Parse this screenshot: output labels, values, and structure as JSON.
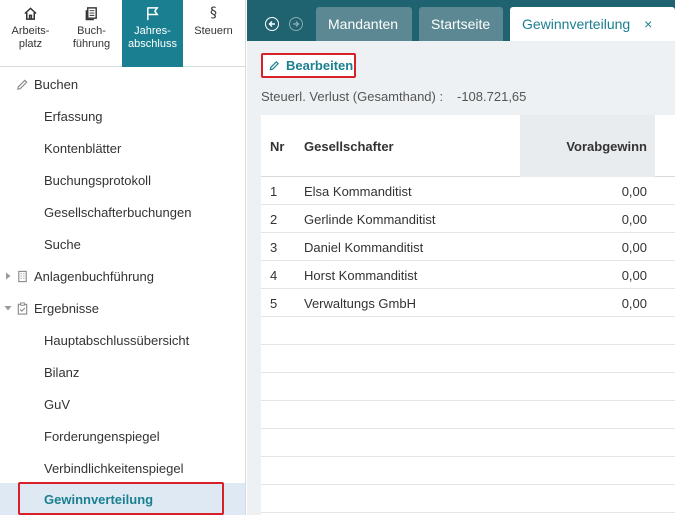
{
  "topnav": [
    {
      "label": "Arbeits-\nplatz",
      "icon": "home-icon",
      "active": false
    },
    {
      "label": "Buch-\nführung",
      "icon": "documents-icon",
      "active": false
    },
    {
      "label": "Jahres-\nabschluss",
      "icon": "flag-icon",
      "active": true
    },
    {
      "label": "Steuern",
      "icon": "paragraph-icon",
      "active": false
    }
  ],
  "tree": {
    "buchen": "Buchen",
    "erfassung": "Erfassung",
    "kontenblaetter": "Kontenblätter",
    "buchungsprotokoll": "Buchungsprotokoll",
    "gesellschafterbuchungen": "Gesellschafterbuchungen",
    "suche": "Suche",
    "anlagenbuchfuehrung": "Anlagenbuchführung",
    "ergebnisse": "Ergebnisse",
    "hauptabschlussuebersicht": "Hauptabschlussübersicht",
    "bilanz": "Bilanz",
    "guv": "GuV",
    "forderungsspiegel": "Forderungenspiegel",
    "verbindlichkeitenspiegel": "Verbindlichkeitenspiegel",
    "gewinnverteilung": "Gewinnverteilung"
  },
  "tabs": {
    "mandanten": "Mandanten",
    "startseite": "Startseite",
    "gewinnverteilung": "Gewinnverteilung",
    "close": "×"
  },
  "content": {
    "edit_label": "Bearbeiten",
    "verlust_label": "Steuerl. Verlust (Gesamthand) :",
    "verlust_value": "-108.721,65"
  },
  "table": {
    "headers": {
      "nr": "Nr",
      "gesellschafter": "Gesellschafter",
      "vorabgewinn": "Vorabgewinn"
    },
    "rows": [
      {
        "nr": "1",
        "name": "Elsa Kommanditist",
        "vorab": "0,00"
      },
      {
        "nr": "2",
        "name": "Gerlinde Kommanditist",
        "vorab": "0,00"
      },
      {
        "nr": "3",
        "name": "Daniel Kommanditist",
        "vorab": "0,00"
      },
      {
        "nr": "4",
        "name": "Horst Kommanditist",
        "vorab": "0,00"
      },
      {
        "nr": "5",
        "name": "Verwaltungs GmbH",
        "vorab": "0,00"
      }
    ]
  },
  "colors": {
    "accent": "#1a7f90",
    "tabbar": "#1f6270",
    "highlight": "#d62128",
    "selected_bg": "#dfe9f3"
  }
}
